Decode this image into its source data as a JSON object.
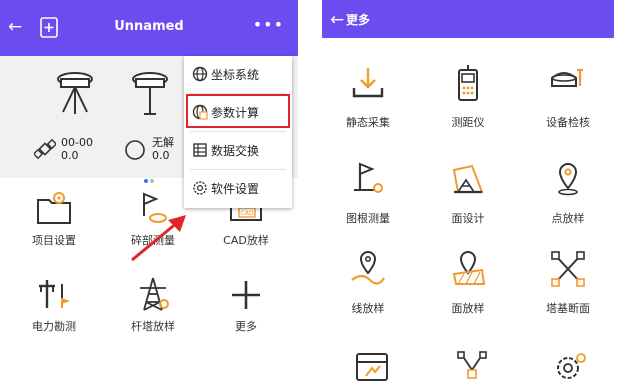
{
  "left_screen": {
    "appbar": {
      "back_glyph": "←",
      "title": "Unnamed",
      "more_glyph": "•••"
    },
    "gps_status": [
      {
        "icon": "satellite-icon",
        "line1": "00-00",
        "line2": "0.0"
      },
      {
        "icon": "circle-icon",
        "line1": "无解",
        "line2": "0.0"
      }
    ],
    "grid": [
      {
        "label": "项目设置",
        "icon": "folder-gear-icon"
      },
      {
        "label": "碎部测量",
        "icon": "flag-survey-icon"
      },
      {
        "label": "CAD放样",
        "icon": "cad-icon"
      },
      {
        "label": "电力勘测",
        "icon": "power-pole-icon"
      },
      {
        "label": "杆塔放样",
        "icon": "tower-icon"
      },
      {
        "label": "更多",
        "icon": "plus-icon"
      }
    ],
    "menu": [
      {
        "label": "坐标系统",
        "icon": "globe-icon"
      },
      {
        "label": "参数计算",
        "icon": "calculator-globe-icon"
      },
      {
        "label": "数据交换",
        "icon": "data-exchange-icon"
      },
      {
        "label": "软件设置",
        "icon": "settings-icon"
      }
    ],
    "cad_badge": "CAD"
  },
  "right_screen": {
    "appbar": {
      "back_glyph": "←",
      "title": "更多"
    },
    "grid": [
      {
        "label": "静态采集",
        "icon": "static-collect-icon"
      },
      {
        "label": "测距仪",
        "icon": "rangefinder-icon"
      },
      {
        "label": "设备检核",
        "icon": "device-check-icon"
      },
      {
        "label": "图根测量",
        "icon": "control-survey-icon"
      },
      {
        "label": "面设计",
        "icon": "surface-design-icon"
      },
      {
        "label": "点放样",
        "icon": "point-stakeout-icon"
      },
      {
        "label": "线放样",
        "icon": "line-stakeout-icon"
      },
      {
        "label": "面放样",
        "icon": "surface-stakeout-icon"
      },
      {
        "label": "塔基断面",
        "icon": "tower-section-icon"
      }
    ]
  },
  "colors": {
    "appbar": "#6a4cf0",
    "accent_orange": "#f29a2e",
    "highlight_red": "#e0262b",
    "icon_dark": "#333333"
  }
}
